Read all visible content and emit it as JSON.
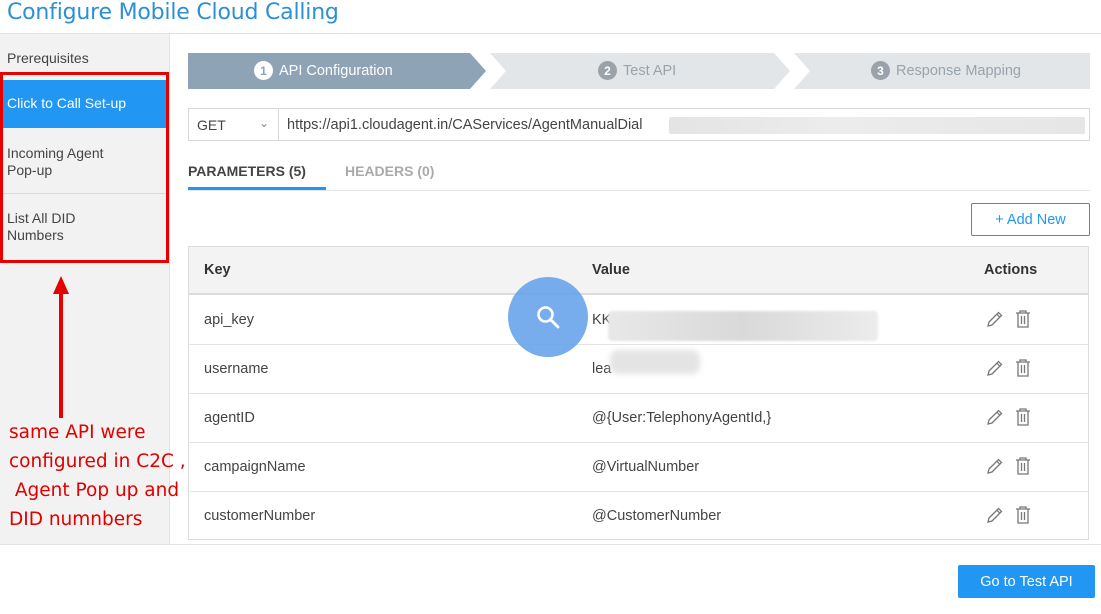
{
  "header": {
    "title": "Configure Mobile Cloud Calling"
  },
  "sidebar": {
    "items": [
      {
        "label": "Prerequisites"
      },
      {
        "label": "Click to Call Set-up"
      },
      {
        "label": "Incoming Agent Pop-up"
      },
      {
        "label": "List All DID Numbers"
      }
    ],
    "active_index": 1
  },
  "annotation": {
    "note": "same API were\nconfigured in C2C ,\n Agent Pop up and\nDID numnbers",
    "color": "#e00000"
  },
  "stepper": {
    "steps": [
      {
        "num": "1",
        "label": "API Configuration",
        "state": "active"
      },
      {
        "num": "2",
        "label": "Test API",
        "state": "inactive"
      },
      {
        "num": "3",
        "label": "Response Mapping",
        "state": "inactive"
      }
    ]
  },
  "request": {
    "method": "GET",
    "url": "https://api1.cloudagent.in/CAServices/AgentManualDial"
  },
  "tabs": [
    {
      "label": "PARAMETERS (5)",
      "active": true
    },
    {
      "label": "HEADERS (0)",
      "active": false
    }
  ],
  "buttons": {
    "add_new": "+ Add New",
    "go_to_test": "Go to Test API"
  },
  "table": {
    "columns": [
      "Key",
      "Value",
      "Actions"
    ],
    "rows": [
      {
        "key": "api_key",
        "value": "KK"
      },
      {
        "key": "username",
        "value": "lea"
      },
      {
        "key": "agentID",
        "value": "@{User:TelephonyAgentId,}"
      },
      {
        "key": "campaignName",
        "value": "@VirtualNumber"
      },
      {
        "key": "customerNumber",
        "value": "@CustomerNumber"
      }
    ],
    "row_actions": [
      "edit-icon",
      "trash-icon"
    ]
  },
  "colors": {
    "accent": "#2196f3",
    "title": "#2d8fd5",
    "step_active": "#8ea3b5",
    "step_inactive": "#e3e6e9"
  }
}
